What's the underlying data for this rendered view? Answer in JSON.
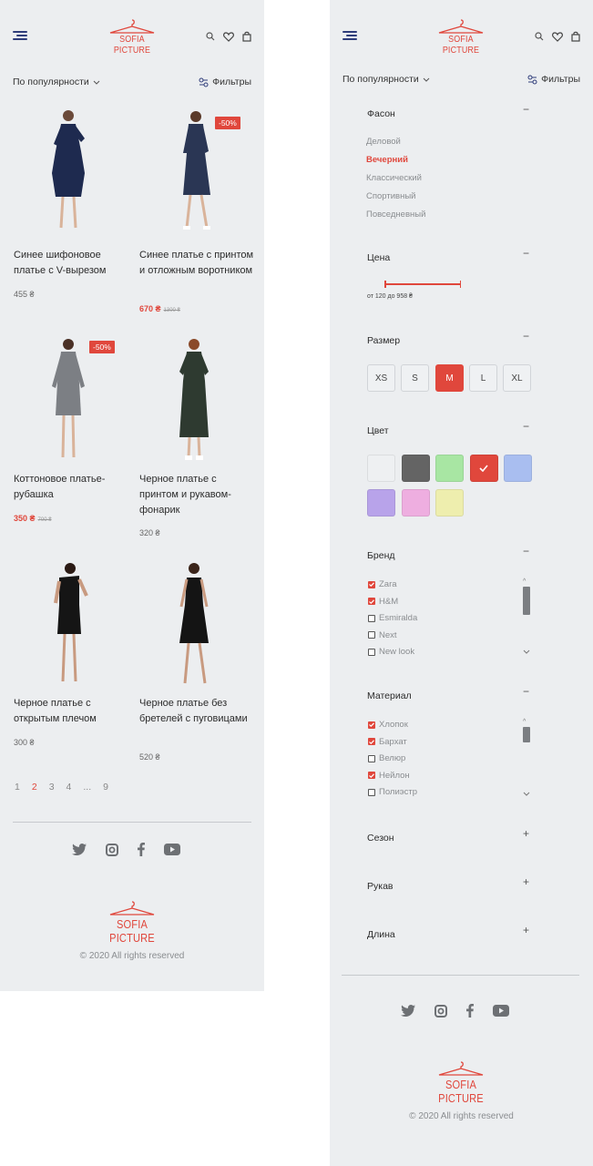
{
  "brand": {
    "logo_text": "SOFIA PICTURE",
    "accent": "#e0473c"
  },
  "catalog": {
    "sort_label": "По популярности",
    "filter_label": "Фильтры",
    "products": [
      {
        "title": "Синее шифоновое платье с V-вырезом",
        "price": "455 ₴",
        "old_price": "",
        "sale_badge": "",
        "dress_color": "#1e2a4f"
      },
      {
        "title": "Синее платье с принтом и отложным воротником",
        "price": "670 ₴",
        "old_price": "1300 ₴",
        "sale_badge": "-50%",
        "dress_color": "#2a3654"
      },
      {
        "title": "Коттоновое платье-рубашка",
        "price": "350 ₴",
        "old_price": "700 ₴",
        "sale_badge": "-50%",
        "dress_color": "#7c7f84"
      },
      {
        "title": "Черное платье с принтом и рукавом-фонарик",
        "price": "320 ₴",
        "old_price": "",
        "sale_badge": "",
        "dress_color": "#2e3a30"
      },
      {
        "title": "Черное платье с открытым плечом",
        "price": "300 ₴",
        "old_price": "",
        "sale_badge": "",
        "dress_color": "#151515"
      },
      {
        "title": "Черное платье без бретелей с пуговицами",
        "price": "520 ₴",
        "old_price": "",
        "sale_badge": "",
        "dress_color": "#141414"
      }
    ],
    "pagination": [
      "1",
      "2",
      "3",
      "4",
      "...",
      "9"
    ],
    "active_page": "2"
  },
  "footer": {
    "copyright": "© 2020 All rights reserved",
    "socials": [
      "twitter-icon",
      "instagram-icon",
      "facebook-icon",
      "youtube-icon"
    ]
  },
  "filters": {
    "style": {
      "title": "Фасон",
      "toggle": "−",
      "options": [
        "Деловой",
        "Вечерний",
        "Классический",
        "Спортивный",
        "Повседневный"
      ],
      "active": "Вечерний"
    },
    "price": {
      "title": "Цена",
      "toggle": "−",
      "range_text": "от 120 до 958 ₴"
    },
    "size": {
      "title": "Размер",
      "toggle": "−",
      "options": [
        "XS",
        "S",
        "M",
        "L",
        "XL"
      ],
      "active": "M"
    },
    "color": {
      "title": "Цвет",
      "toggle": "−",
      "swatches": [
        "#eef0f2",
        "#646464",
        "#a8e6a3",
        "#e0473c",
        "#a9bef0",
        "#b8a3ea",
        "#eeaee0",
        "#eeeeae"
      ],
      "selected_index": 3
    },
    "brand": {
      "title": "Бренд",
      "toggle": "−",
      "items": [
        {
          "label": "Zara",
          "checked": true
        },
        {
          "label": "H&M",
          "checked": true
        },
        {
          "label": "Esmiralda",
          "checked": false
        },
        {
          "label": "Next",
          "checked": false
        },
        {
          "label": "New look",
          "checked": false
        }
      ]
    },
    "material": {
      "title": "Материал",
      "toggle": "−",
      "items": [
        {
          "label": "Хлопок",
          "checked": true
        },
        {
          "label": "Бархат",
          "checked": true
        },
        {
          "label": "Велюр",
          "checked": false
        },
        {
          "label": "Нейлон",
          "checked": true
        },
        {
          "label": "Полиэстр",
          "checked": false
        }
      ]
    },
    "season": {
      "title": "Сезон",
      "toggle": "+"
    },
    "sleeve": {
      "title": "Рукав",
      "toggle": "+"
    },
    "length": {
      "title": "Длина",
      "toggle": "+"
    }
  }
}
